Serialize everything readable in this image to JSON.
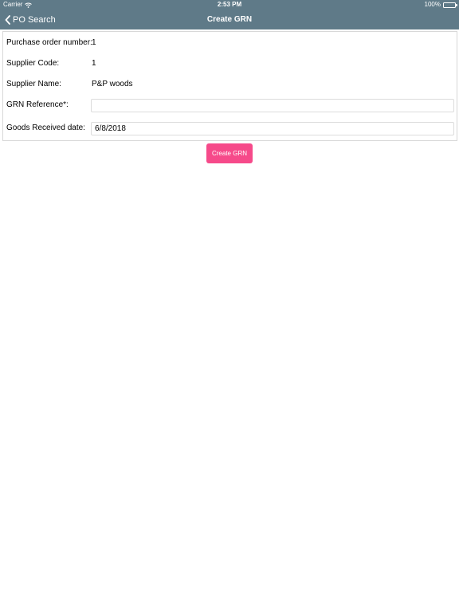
{
  "status_bar": {
    "carrier": "Carrier",
    "time": "2:53 PM",
    "battery": "100%"
  },
  "nav": {
    "back_label": "PO Search",
    "title": "Create GRN"
  },
  "form": {
    "po_number_label": "Purchase order number:",
    "po_number_value": "1",
    "supplier_code_label": "Supplier Code:",
    "supplier_code_value": "1",
    "supplier_name_label": "Supplier Name:",
    "supplier_name_value": "P&P woods",
    "grn_reference_label": "GRN Reference*:",
    "grn_reference_value": "",
    "goods_received_label": "Goods Received date:",
    "goods_received_value": "6/8/2018"
  },
  "actions": {
    "create_label": "Create GRN"
  },
  "colors": {
    "header_bg": "#5f7a88",
    "button_bg": "#f64a8a"
  }
}
